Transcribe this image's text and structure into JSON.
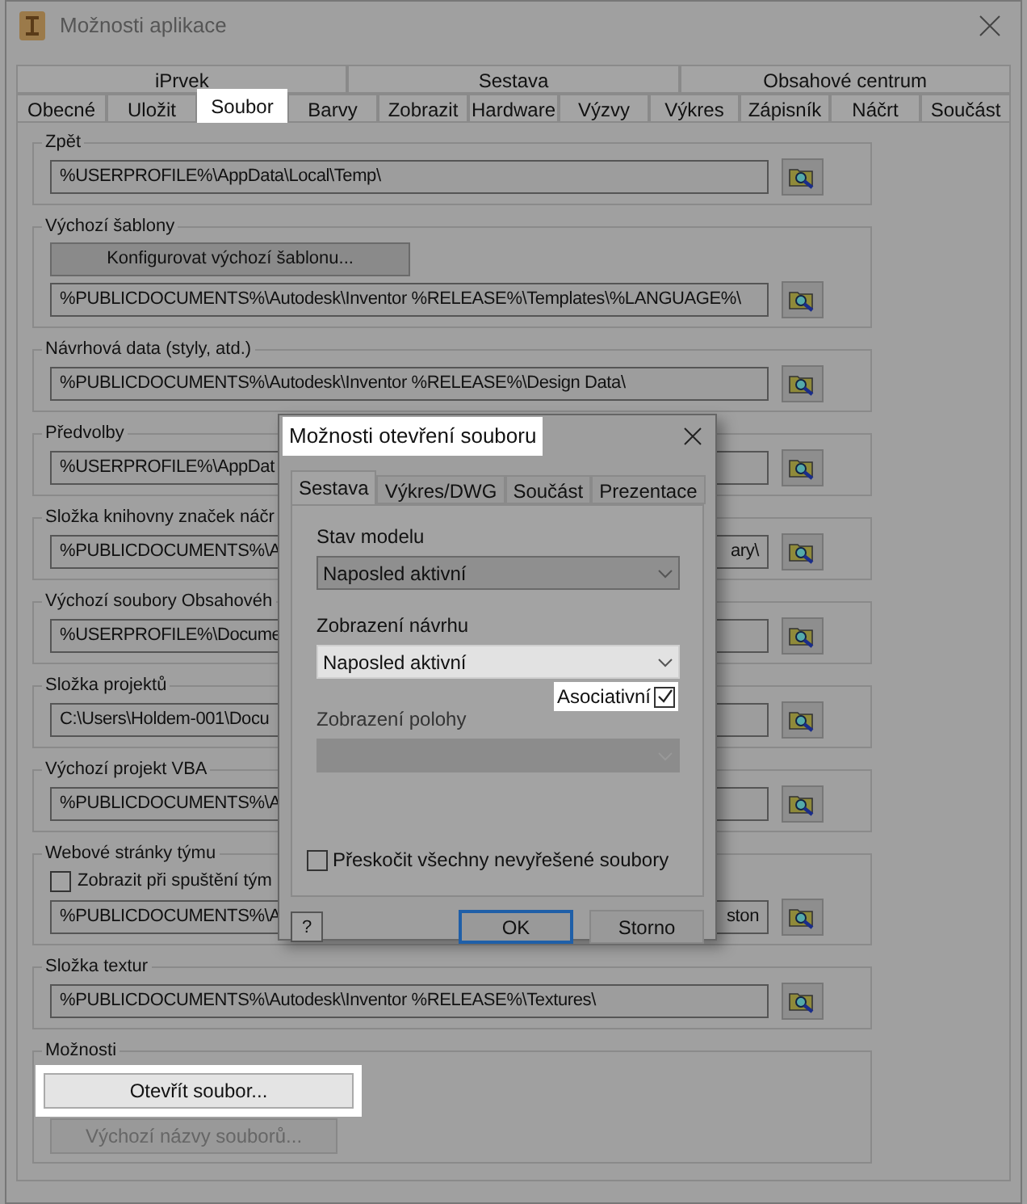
{
  "window": {
    "title": "Možnosti aplikace"
  },
  "tabs_row_1": [
    {
      "label": "iPrvek",
      "selected": false
    },
    {
      "label": "Sestava",
      "selected": false
    },
    {
      "label": "Obsahové centrum",
      "selected": false
    }
  ],
  "tabs_row_2": [
    {
      "label": "Obecné",
      "selected": false
    },
    {
      "label": "Uložit",
      "selected": false
    },
    {
      "label": "Soubor",
      "selected": true
    },
    {
      "label": "Barvy",
      "selected": false
    },
    {
      "label": "Zobrazit",
      "selected": false
    },
    {
      "label": "Hardware",
      "selected": false
    },
    {
      "label": "Výzvy",
      "selected": false
    },
    {
      "label": "Výkres",
      "selected": false
    },
    {
      "label": "Zápisník",
      "selected": false
    },
    {
      "label": "Náčrt",
      "selected": false
    },
    {
      "label": "Součást",
      "selected": false
    }
  ],
  "sections": [
    {
      "kind": "path",
      "label": "Zpět",
      "path": {
        "left": "%USERPROFILE%\\AppData\\Local\\Temp\\"
      }
    },
    {
      "kind": "button_path",
      "label": "Výchozí šablony",
      "button": "Konfigurovat výchozí šablonu...",
      "path": {
        "left": "%PUBLICDOCUMENTS%\\Autodesk\\Inventor %RELEASE%\\Templates\\%LANGUAGE%\\"
      }
    },
    {
      "kind": "path",
      "label": "Návrhová data (styly, atd.)",
      "path": {
        "left": "%PUBLICDOCUMENTS%\\Autodesk\\Inventor %RELEASE%\\Design Data\\"
      }
    },
    {
      "kind": "path",
      "label": "Předvolby",
      "path": {
        "left": "%USERPROFILE%\\AppDat"
      }
    },
    {
      "kind": "path",
      "label": "Složka knihovny značek náčr",
      "path": {
        "left": "%PUBLICDOCUMENTS%\\A",
        "right": "ary\\"
      }
    },
    {
      "kind": "path",
      "label": "Výchozí soubory Obsahovéh",
      "path": {
        "left": "%USERPROFILE%\\Docume"
      }
    },
    {
      "kind": "path",
      "label": "Složka projektů",
      "path": {
        "left": "C:\\Users\\Holdem-001\\Docu"
      }
    },
    {
      "kind": "path",
      "label": "Výchozí projekt VBA",
      "path": {
        "left": "%PUBLICDOCUMENTS%\\A"
      }
    },
    {
      "kind": "checkbox_path",
      "label": "Webové stránky týmu",
      "checkbox": {
        "label": "Zobrazit při spuštění tým",
        "checked": false
      },
      "path": {
        "left": "%PUBLICDOCUMENTS%\\A",
        "right": "ston"
      }
    },
    {
      "kind": "path",
      "label": "Složka textur",
      "path": {
        "left": "%PUBLICDOCUMENTS%\\Autodesk\\Inventor %RELEASE%\\Textures\\"
      }
    },
    {
      "kind": "buttons",
      "label": "Možnosti",
      "buttons": [
        {
          "label": "Otevřít soubor...",
          "highlighted": true,
          "disabled": false
        },
        {
          "label": "Výchozí názvy souborů...",
          "highlighted": false,
          "disabled": true
        }
      ]
    }
  ],
  "dialog": {
    "title": "Možnosti otevření souboru",
    "title_highlighted": true,
    "tabs": [
      {
        "label": "Sestava",
        "selected": true
      },
      {
        "label": "Výkres/DWG",
        "selected": false
      },
      {
        "label": "Součást",
        "selected": false
      },
      {
        "label": "Prezentace",
        "selected": false
      }
    ],
    "stav_modelu": {
      "label": "Stav modelu",
      "value": "Naposled aktivní",
      "highlighted": false,
      "disabled": false
    },
    "zobrazeni_navrhu": {
      "label": "Zobrazení návrhu",
      "value": "Naposled aktivní",
      "highlighted": true,
      "disabled": false
    },
    "asociativni": {
      "label": "Asociativní",
      "checked": true,
      "highlighted": true
    },
    "zobrazeni_polohy": {
      "label": "Zobrazení polohy",
      "highlighted": false,
      "disabled": true
    },
    "skip_unresolved": {
      "label": "Přeskočit všechny nevyřešené soubory",
      "checked": false
    },
    "help_button": "?",
    "buttons": [
      {
        "label": "OK",
        "default": true
      },
      {
        "label": "Storno",
        "default": false
      }
    ]
  }
}
